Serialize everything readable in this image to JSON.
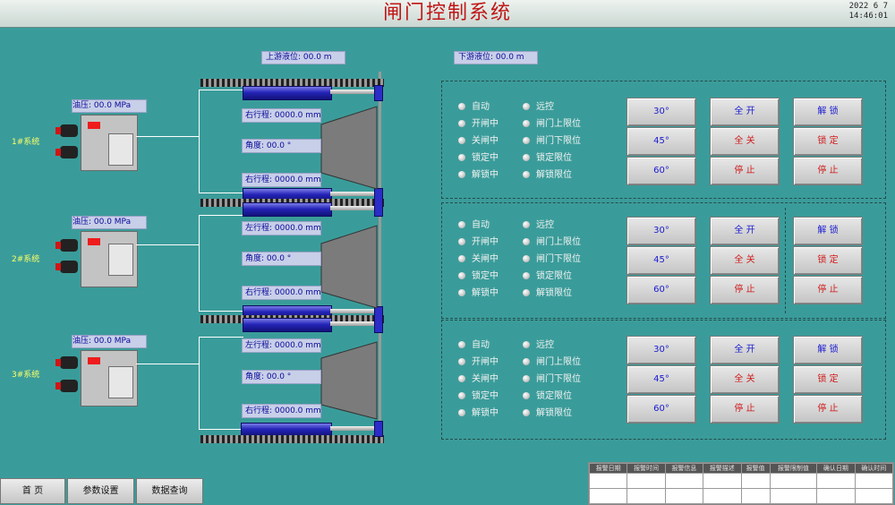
{
  "header": {
    "title": "闸门控制系统",
    "date": "2022 6 7",
    "time": "14:46:01"
  },
  "levels": {
    "upstream": "上游液位: 00.0  m",
    "downstream": "下游液位: 00.0  m"
  },
  "systems": [
    {
      "label": "1#系统",
      "oil": "油压:    00.0   MPa",
      "right_stroke_top": "右行程: 0000.0 mm",
      "angle": "角度:     00.0   °",
      "right_stroke_bottom": "右行程: 0000.0 mm"
    },
    {
      "label": "2#系统",
      "oil": "油压:    00.0   MPa",
      "right_stroke_top": "左行程: 0000.0 mm",
      "angle": "角度:     00.0   °",
      "right_stroke_bottom": "右行程: 0000.0 mm"
    },
    {
      "label": "3#系统",
      "oil": "油压:    00.0   MPa",
      "right_stroke_top": "左行程: 0000.0 mm",
      "angle": "角度:     00.0   °",
      "right_stroke_bottom": "右行程: 0000.0 mm"
    }
  ],
  "status_left": [
    "自动",
    "开闸中",
    "关闸中",
    "锁定中",
    "解锁中"
  ],
  "status_right": [
    "远控",
    "闸门上限位",
    "闸门下限位",
    "锁定限位",
    "解锁限位"
  ],
  "angle_buttons": [
    "30°",
    "45°",
    "60°"
  ],
  "gate_buttons": [
    "全 开",
    "全 关",
    "停 止"
  ],
  "lock_buttons": [
    "解 锁",
    "锁 定",
    "停 止"
  ],
  "nav": [
    "首 页",
    "参数设置",
    "数据查询"
  ],
  "alarm_headers": [
    "报警日期",
    "报警时间",
    "报警信息",
    "报警描述",
    "报警值",
    "报警限制值",
    "确认日期",
    "确认时间"
  ],
  "colors": {
    "background": "#3a9c9a",
    "title": "#c01515",
    "accent_blue": "#1a1ad0",
    "accent_red": "#d01818"
  }
}
